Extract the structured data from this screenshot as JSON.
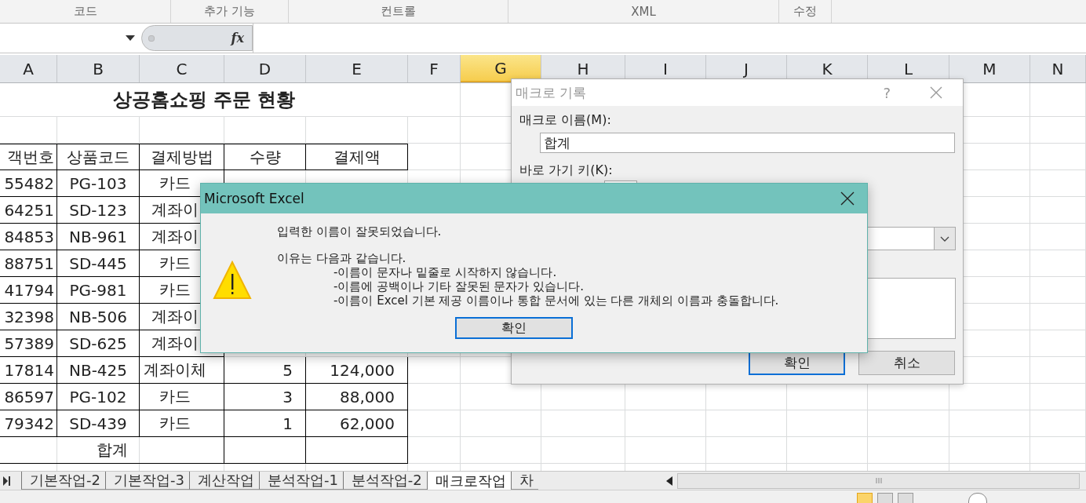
{
  "ribbon_groups": [
    "코드",
    "추가 기능",
    "컨트롤",
    "XML",
    "수정"
  ],
  "formula_bar": {
    "function_label": "fx"
  },
  "columns": [
    {
      "label": "A",
      "selected": false
    },
    {
      "label": "B",
      "selected": false
    },
    {
      "label": "C",
      "selected": false
    },
    {
      "label": "D",
      "selected": false
    },
    {
      "label": "E",
      "selected": false
    },
    {
      "label": "F",
      "selected": false
    },
    {
      "label": "G",
      "selected": true
    },
    {
      "label": "H",
      "selected": false
    },
    {
      "label": "I",
      "selected": false
    },
    {
      "label": "J",
      "selected": false
    },
    {
      "label": "K",
      "selected": false
    },
    {
      "label": "L",
      "selected": false
    },
    {
      "label": "M",
      "selected": false
    },
    {
      "label": "N",
      "selected": false
    }
  ],
  "sheet": {
    "title": "상공홈쇼핑 주문 현황",
    "headers": [
      "객번호",
      "상품코드",
      "결제방법",
      "수량",
      "결제액"
    ],
    "rows": [
      [
        "55482",
        "PG-103",
        "카드"
      ],
      [
        "64251",
        "SD-123",
        "계좌이"
      ],
      [
        "84853",
        "NB-961",
        "계좌이"
      ],
      [
        "88751",
        "SD-445",
        "카드"
      ],
      [
        "41794",
        "PG-981",
        "카드"
      ],
      [
        "32398",
        "NB-506",
        "계좌이"
      ],
      [
        "57389",
        "SD-625",
        "계좌이"
      ],
      [
        "17814",
        "NB-425",
        "계좌이체",
        "5",
        "124,000"
      ],
      [
        "86597",
        "PG-102",
        "카드",
        "3",
        "88,000"
      ],
      [
        "79342",
        "SD-439",
        "카드",
        "1",
        "62,000"
      ]
    ],
    "total_label": "합계"
  },
  "macro_dialog": {
    "title": "매크로 기록",
    "help": "?",
    "name_label": "매크로 이름(M):",
    "name_value": "합계",
    "shortcut_label": "바로 가기 키(K):",
    "buttons": [
      {
        "label": "확인",
        "focused": true
      },
      {
        "label": "취소",
        "focused": false
      }
    ]
  },
  "message_box": {
    "title": "Microsoft Excel",
    "message": "입력한 이름이 잘못되었습니다.",
    "reason_heading": "이유는 다음과 같습니다.",
    "reasons": [
      "-이름이 문자나 밑줄로 시작하지 않습니다.",
      "-이름에 공백이나 기타 잘못된 문자가 있습니다.",
      "-이름이 Excel 기본 제공 이름이나 통합 문서에 있는 다른 개체의 이름과 충돌합니다."
    ],
    "button": "확인"
  },
  "sheet_tabs": [
    {
      "label": "기본작업-2",
      "selected": false
    },
    {
      "label": "기본작업-3",
      "selected": false
    },
    {
      "label": "계산작업",
      "selected": false
    },
    {
      "label": "분석작업-1",
      "selected": false
    },
    {
      "label": "분석작업-2",
      "selected": false
    },
    {
      "label": "매크로작업",
      "selected": true
    },
    {
      "label": "차",
      "selected": false
    }
  ],
  "status_bar": {
    "views": [
      {
        "selected": true
      },
      {
        "selected": false
      },
      {
        "selected": false
      }
    ]
  }
}
